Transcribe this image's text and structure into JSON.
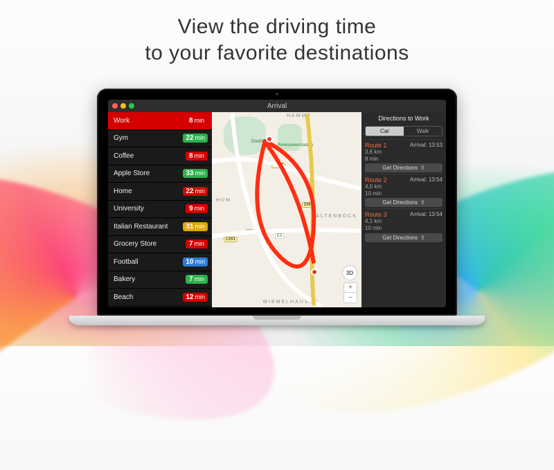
{
  "headline": {
    "l1": "View the driving time",
    "l2": "to your favorite destinations"
  },
  "app": {
    "title": "Arrival"
  },
  "destinations": [
    {
      "name": "Work",
      "time": "8",
      "unit": "min",
      "color": "red",
      "selected": true
    },
    {
      "name": "Gym",
      "time": "22",
      "unit": "min",
      "color": "green"
    },
    {
      "name": "Coffee",
      "time": "8",
      "unit": "min",
      "color": "red"
    },
    {
      "name": "Apple Store",
      "time": "33",
      "unit": "min",
      "color": "green"
    },
    {
      "name": "Home",
      "time": "22",
      "unit": "min",
      "color": "red"
    },
    {
      "name": "University",
      "time": "9",
      "unit": "min",
      "color": "red"
    },
    {
      "name": "Italian Restaurant",
      "time": "31",
      "unit": "min",
      "color": "yellow"
    },
    {
      "name": "Grocery Store",
      "time": "7",
      "unit": "min",
      "color": "red"
    },
    {
      "name": "Football",
      "time": "10",
      "unit": "min",
      "color": "blue"
    },
    {
      "name": "Bakery",
      "time": "7",
      "unit": "min",
      "color": "green"
    },
    {
      "name": "Beach",
      "time": "12",
      "unit": "min",
      "color": "red"
    }
  ],
  "map": {
    "labels": {
      "hum": "HUM",
      "wiemelhausen": "WIEMELHAUSEN",
      "altenbock": "ALTENBOCK",
      "hamme": "HAMME",
      "stadtpark": "Stadtpark",
      "rewirpower": "Rewirpowerstadion"
    },
    "roads": {
      "a": "L654",
      "b": "L551",
      "c": "226",
      "d": "E2",
      "e": "E3"
    },
    "controls": {
      "three_d": "3D",
      "plus": "+",
      "minus": "−"
    }
  },
  "directions": {
    "heading": "Directions to Work",
    "mode": {
      "car": "Car",
      "walk": "Walk"
    },
    "get_label": "Get Directions",
    "routes": [
      {
        "name": "Route 1",
        "arrival": "Arrival: 13:53",
        "dist": "3,6 km",
        "dur": "8 min"
      },
      {
        "name": "Route 2",
        "arrival": "Arrival: 13:54",
        "dist": "4,0 km",
        "dur": "10 min"
      },
      {
        "name": "Route 3",
        "arrival": "Arrival: 13:54",
        "dist": "4,1 km",
        "dur": "10 min"
      }
    ]
  }
}
